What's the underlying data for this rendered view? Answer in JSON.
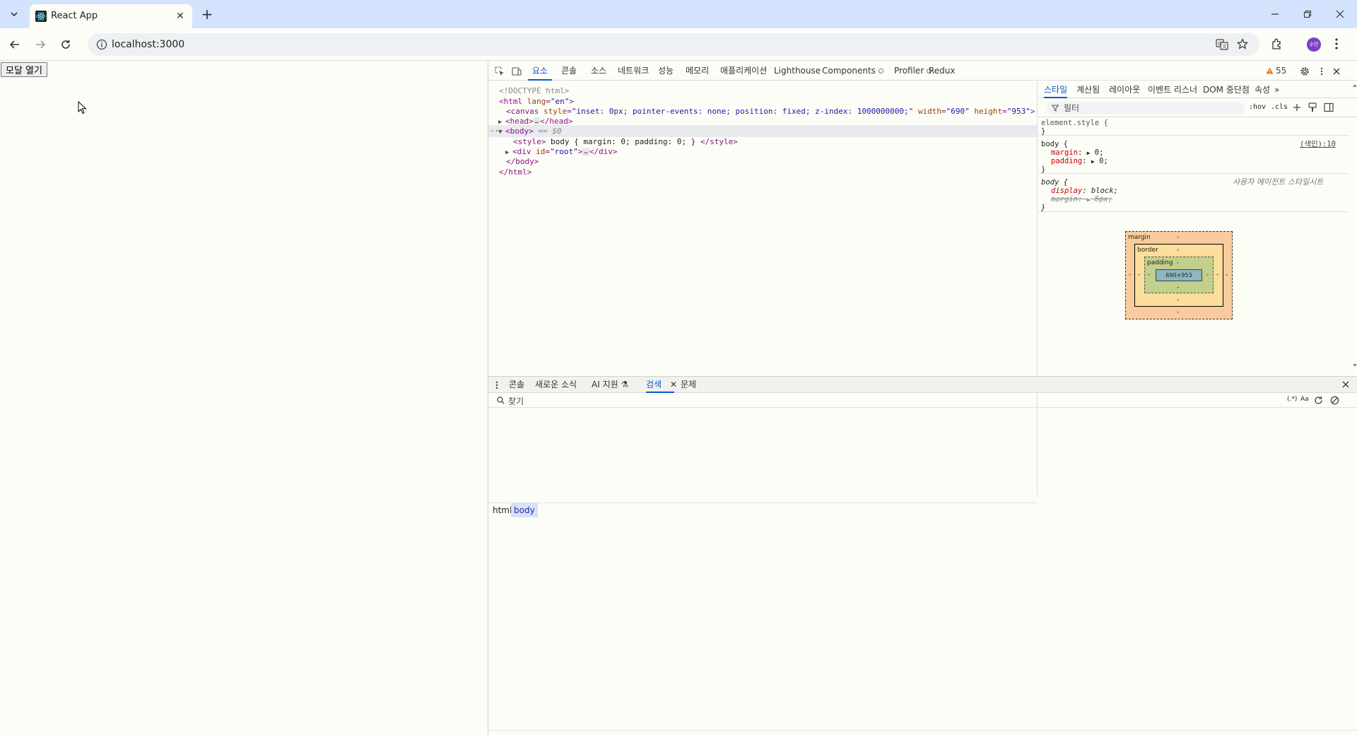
{
  "browser": {
    "tab_title": "React App",
    "url": "localhost:3000",
    "profile_initials": "수민"
  },
  "page": {
    "open_modal_label": "모달 열기"
  },
  "devtools": {
    "tabs": [
      "요소",
      "콘솔",
      "소스",
      "네트워크",
      "성능",
      "메모리",
      "애플리케이션",
      "Lighthouse",
      "Components",
      "Profiler",
      "Redux"
    ],
    "active_tab": "요소",
    "warning_count": "55",
    "dom": {
      "doctype": "<!DOCTYPE html>",
      "html_open_tag": "html",
      "html_lang_attr": "lang",
      "html_lang_val": "\"en\"",
      "canvas_tag": "canvas",
      "canvas_style_attr": "style",
      "canvas_style_val": "\"inset: 0px; pointer-events: none; position: fixed; z-index: 1000000000;\"",
      "canvas_width_attr": "width",
      "canvas_width_val": "\"690\"",
      "canvas_height_attr": "height",
      "canvas_height_val": "\"953\"",
      "head_open": "<head>",
      "head_close": "</head>",
      "body_open": "<body>",
      "body_marker": "== $0",
      "style_open": "<style>",
      "style_content": " body { margin: 0; padding: 0; } ",
      "style_close": "</style>",
      "div_tag": "div",
      "div_id_attr": "id",
      "div_id_val": "\"root\"",
      "div_close": "</div>",
      "body_close": "</body>",
      "html_close": "</html>",
      "ellipsis": "…",
      "dots": "···"
    },
    "breadcrumb": [
      "html",
      "body"
    ],
    "styles_subtabs": [
      "스타일",
      "계산됨",
      "레이아웃",
      "이벤트 리스너",
      "DOM 중단점",
      "속성"
    ],
    "filter_placeholder": "필터",
    "hov_label": ":hov",
    "cls_label": ".cls",
    "element_style_selector": "element.style {",
    "close_brace": "}",
    "rule1": {
      "selector": "body {",
      "source": "(색인):10",
      "props": [
        {
          "name": "margin",
          "value": "0;"
        },
        {
          "name": "padding",
          "value": "0;"
        }
      ]
    },
    "rule2": {
      "selector": "body {",
      "source": "사용자 에이전트 스타일시트",
      "props": [
        {
          "name": "display",
          "value": "block;"
        },
        {
          "name": "margin",
          "value": "8px;"
        }
      ]
    },
    "box_model": {
      "margin_label": "margin",
      "border_label": "border",
      "padding_label": "padding",
      "content_size": "690×953",
      "dash": "-"
    },
    "drawer_tabs": [
      "콘솔",
      "새로운 소식",
      "AI 지원",
      "검색",
      "문제"
    ],
    "drawer_active_tab": "검색",
    "search_placeholder": "찾기",
    "regex_label": "(.*)",
    "case_label": "Aa"
  },
  "colors": {
    "accent": "#0b57d0",
    "tabstrip": "#d3e3fd",
    "margin_box": "#f9cc9d",
    "border_box": "#fddd9b",
    "padding_box": "#c3d08b",
    "content_box": "#8cb6c0"
  }
}
